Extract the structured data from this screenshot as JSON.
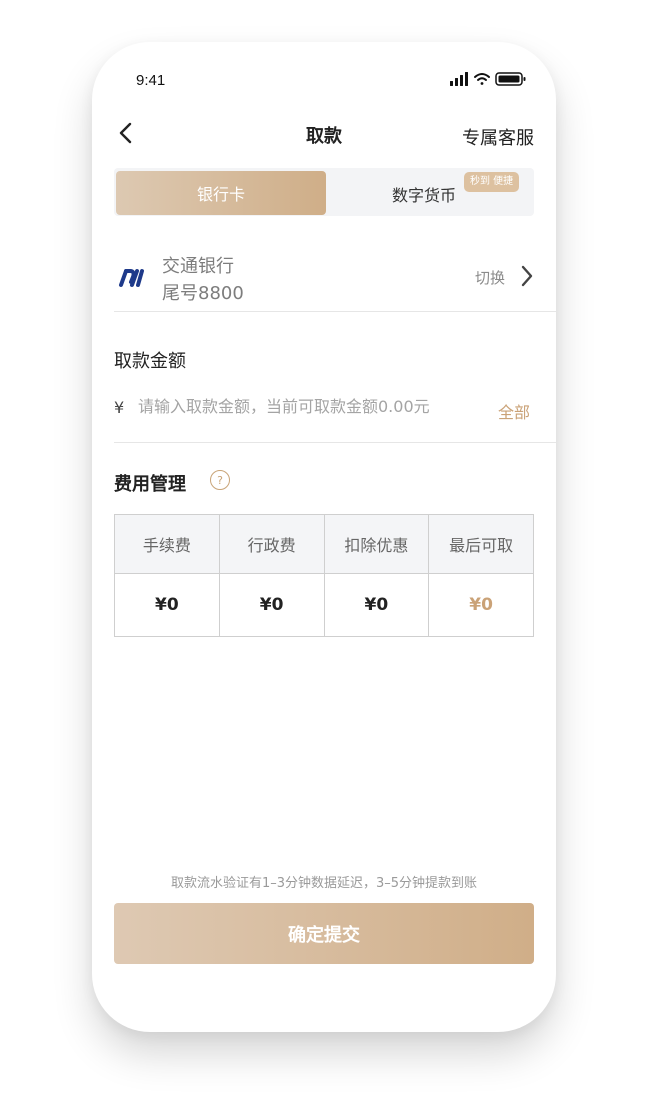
{
  "status": {
    "time": "9:41"
  },
  "header": {
    "title": "取款",
    "service": "专属客服"
  },
  "tabs": {
    "active": "银行卡",
    "other": "数字货币",
    "badge": "秒到 便捷"
  },
  "bank": {
    "name": "交通银行",
    "tail": "尾号8800",
    "switch": "切换"
  },
  "amount": {
    "label": "取款金额",
    "currency": "¥",
    "value": "",
    "placeholder": "请输入取款金额，当前可取款金额0.00元",
    "all": "全部"
  },
  "fees": {
    "title": "费用管理",
    "help_symbol": "?",
    "headers": [
      "手续费",
      "行政费",
      "扣除优惠",
      "最后可取"
    ],
    "values": [
      "¥0",
      "¥0",
      "¥0",
      "¥0"
    ]
  },
  "footer": {
    "notice": "取款流水验证有1–3分钟数据延迟，3–5分钟提款到账",
    "submit": "确定提交"
  },
  "colors": {
    "accent": "#caa277",
    "brand_gradient_start": "#ddc9b2",
    "brand_gradient_end": "#cfae88",
    "bank_logo": "#1e3a8a"
  },
  "icons": {
    "back": "chevron-left-icon",
    "switch": "chevron-right-icon",
    "bank": "bank-of-communications-logo",
    "help": "question-icon"
  }
}
